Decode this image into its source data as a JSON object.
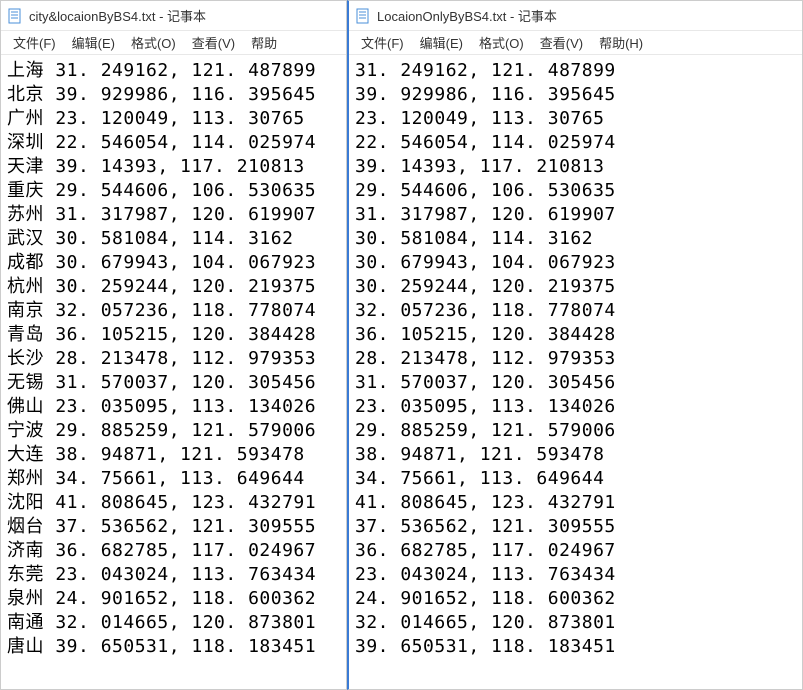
{
  "app_suffix": " - 记事本",
  "left": {
    "filename": "city&locaionByBS4.txt",
    "menus": [
      "文件(F)",
      "编辑(E)",
      "格式(O)",
      "查看(V)",
      "帮助"
    ],
    "rows": [
      {
        "city": "上海",
        "coords": "31. 249162, 121. 487899"
      },
      {
        "city": "北京",
        "coords": "39. 929986, 116. 395645"
      },
      {
        "city": "广州",
        "coords": "23. 120049, 113. 30765"
      },
      {
        "city": "深圳",
        "coords": "22. 546054, 114. 025974"
      },
      {
        "city": "天津",
        "coords": "39. 14393, 117. 210813"
      },
      {
        "city": "重庆",
        "coords": "29. 544606, 106. 530635"
      },
      {
        "city": "苏州",
        "coords": "31. 317987, 120. 619907"
      },
      {
        "city": "武汉",
        "coords": "30. 581084, 114. 3162"
      },
      {
        "city": "成都",
        "coords": "30. 679943, 104. 067923"
      },
      {
        "city": "杭州",
        "coords": "30. 259244, 120. 219375"
      },
      {
        "city": "南京",
        "coords": "32. 057236, 118. 778074"
      },
      {
        "city": "青岛",
        "coords": "36. 105215, 120. 384428"
      },
      {
        "city": "长沙",
        "coords": "28. 213478, 112. 979353"
      },
      {
        "city": "无锡",
        "coords": "31. 570037, 120. 305456"
      },
      {
        "city": "佛山",
        "coords": "23. 035095, 113. 134026"
      },
      {
        "city": "宁波",
        "coords": "29. 885259, 121. 579006"
      },
      {
        "city": "大连",
        "coords": "38. 94871, 121. 593478"
      },
      {
        "city": "郑州",
        "coords": "34. 75661, 113. 649644"
      },
      {
        "city": "沈阳",
        "coords": "41. 808645, 123. 432791"
      },
      {
        "city": "烟台",
        "coords": "37. 536562, 121. 309555"
      },
      {
        "city": "济南",
        "coords": "36. 682785, 117. 024967"
      },
      {
        "city": "东莞",
        "coords": "23. 043024, 113. 763434"
      },
      {
        "city": "泉州",
        "coords": "24. 901652, 118. 600362"
      },
      {
        "city": "南通",
        "coords": "32. 014665, 120. 873801"
      },
      {
        "city": "唐山",
        "coords": "39. 650531, 118. 183451"
      }
    ]
  },
  "right": {
    "filename": "LocaionOnlyByBS4.txt",
    "menus": [
      "文件(F)",
      "编辑(E)",
      "格式(O)",
      "查看(V)",
      "帮助(H)"
    ],
    "rows": [
      "31. 249162, 121. 487899",
      "39. 929986, 116. 395645",
      "23. 120049, 113. 30765",
      "22. 546054, 114. 025974",
      "39. 14393, 117. 210813",
      "29. 544606, 106. 530635",
      "31. 317987, 120. 619907",
      "30. 581084, 114. 3162",
      "30. 679943, 104. 067923",
      "30. 259244, 120. 219375",
      "32. 057236, 118. 778074",
      "36. 105215, 120. 384428",
      "28. 213478, 112. 979353",
      "31. 570037, 120. 305456",
      "23. 035095, 113. 134026",
      "29. 885259, 121. 579006",
      "38. 94871, 121. 593478",
      "34. 75661, 113. 649644",
      "41. 808645, 123. 432791",
      "37. 536562, 121. 309555",
      "36. 682785, 117. 024967",
      "23. 043024, 113. 763434",
      "24. 901652, 118. 600362",
      "32. 014665, 120. 873801",
      "39. 650531, 118. 183451"
    ]
  }
}
